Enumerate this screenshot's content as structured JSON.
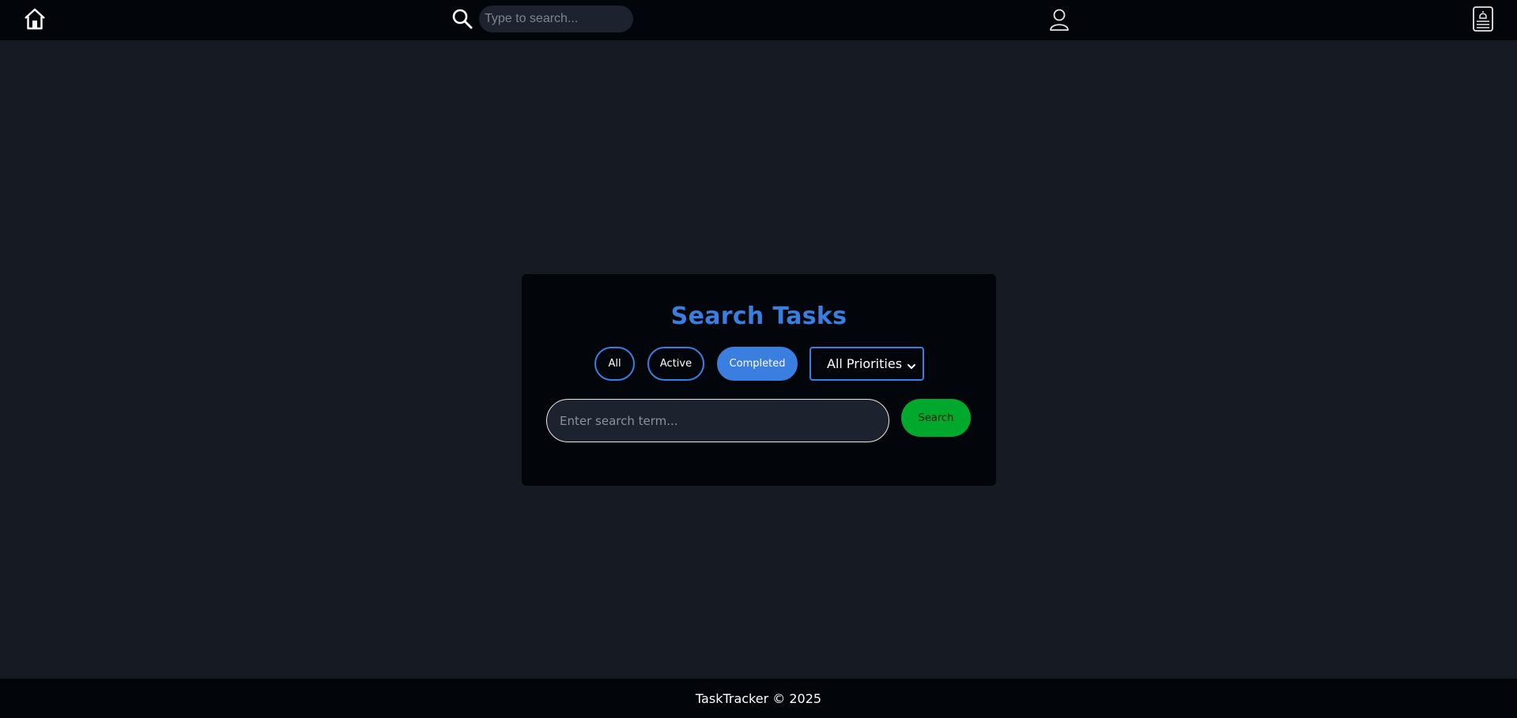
{
  "navbar": {
    "icons": {
      "home": "home-icon",
      "search": "search-icon",
      "user": "user-icon",
      "notifications": "notification-bell-icon"
    },
    "search_placeholder": "Type to search..."
  },
  "card": {
    "title": "Search Tasks",
    "filters": [
      {
        "label": "All",
        "selected": false
      },
      {
        "label": "Active",
        "selected": false
      },
      {
        "label": "Completed",
        "selected": true
      }
    ],
    "priority_select": {
      "value": "All Priorities"
    },
    "search_input": {
      "value": "",
      "placeholder": "Enter search term..."
    },
    "search_button_label": "Search"
  },
  "footer": {
    "text": "TaskTracker © 2025"
  },
  "colors": {
    "accent": "#3a7ee0",
    "search_button": "#00a82b",
    "background": "#161b23",
    "panel": "#02060b"
  }
}
